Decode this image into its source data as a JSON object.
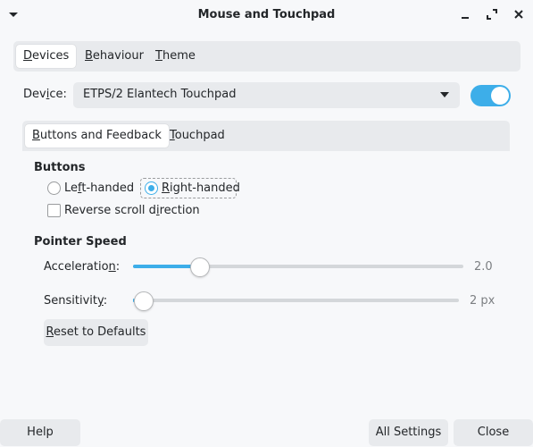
{
  "window": {
    "title": "Mouse and Touchpad"
  },
  "tabs": [
    {
      "pre": "",
      "ul": "D",
      "post": "evices"
    },
    {
      "pre": "",
      "ul": "B",
      "post": "ehaviour"
    },
    {
      "pre": "",
      "ul": "T",
      "post": "heme"
    }
  ],
  "device": {
    "label_pre": "Dev",
    "label_ul": "i",
    "label_post": "ce:",
    "value": "ETPS/2 Elantech Touchpad",
    "enabled": true
  },
  "inner_tabs": [
    {
      "pre": "",
      "ul": "B",
      "post": "uttons and Feedback"
    },
    {
      "pre": "",
      "ul": "T",
      "post": "ouchpad"
    }
  ],
  "buttons_section": {
    "title": "Buttons",
    "left_handed": {
      "pre": "Le",
      "ul": "f",
      "post": "t-handed",
      "selected": false
    },
    "right_handed": {
      "pre": "",
      "ul": "R",
      "post": "ight-handed",
      "selected": true
    },
    "reverse_scroll": {
      "pre": "Reverse scroll d",
      "ul": "i",
      "post": "rection",
      "checked": false
    }
  },
  "pointer_section": {
    "title": "Pointer Speed",
    "acceleration": {
      "pre": "Acceleratio",
      "ul": "n",
      "post": ":",
      "value_text": "2.0",
      "fraction": 0.2
    },
    "sensitivity": {
      "pre": "Sensitivit",
      "ul": "y",
      "post": ":",
      "value_text": "2 px",
      "fraction": 0.0
    }
  },
  "reset_button": {
    "pre": "",
    "ul": "R",
    "post": "eset to Defaults"
  },
  "footer": {
    "help": "Help",
    "all_settings": "All Settings",
    "close": "Close"
  },
  "colors": {
    "accent": "#3daee9",
    "window_bg": "#f7f8fa",
    "panel_bg": "#e8eaed",
    "text": "#232629"
  },
  "icons": {
    "window_menu": "chevron-down-icon",
    "minimize": "minimize-icon",
    "maximize": "maximize-icon",
    "close": "close-icon",
    "combo_arrow": "dropdown-arrow-icon"
  }
}
